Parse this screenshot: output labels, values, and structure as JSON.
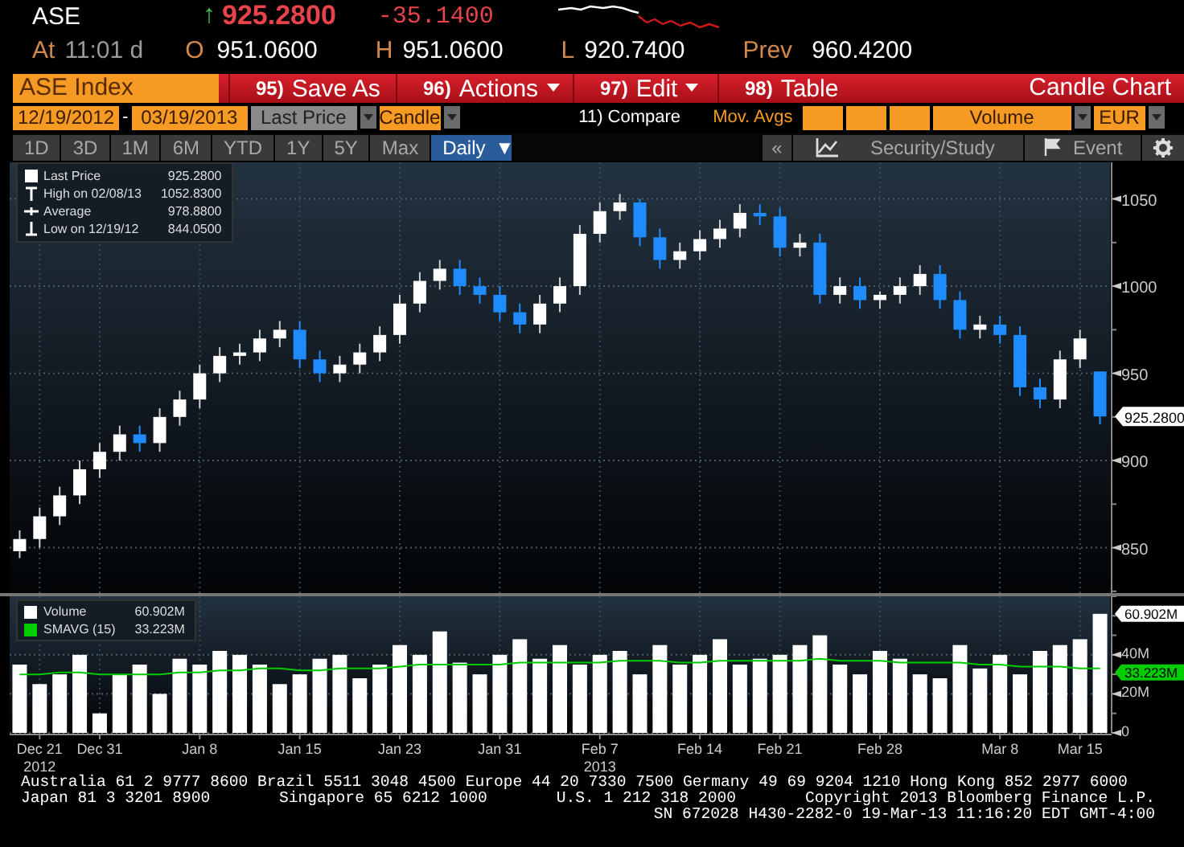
{
  "quote": {
    "ticker": "ASE",
    "arrow": "↑",
    "last": "925.2800",
    "change": "-35.1400",
    "at_label": "At",
    "time": "11:01 d",
    "open_label": "O",
    "open": "951.0600",
    "high_label": "H",
    "high": "951.0600",
    "low_label": "L",
    "low": "920.7400",
    "prev_label": "Prev",
    "prev": "960.4200"
  },
  "menu_bar": {
    "security": "ASE Index",
    "buttons": [
      {
        "number": "95)",
        "label": "Save As",
        "dropdown": false
      },
      {
        "number": "96)",
        "label": "Actions",
        "dropdown": true
      },
      {
        "number": "97)",
        "label": "Edit",
        "dropdown": true
      },
      {
        "number": "98)",
        "label": "Table",
        "dropdown": false
      }
    ],
    "title": "Candle Chart"
  },
  "settings_bar": {
    "start_date": "12/19/2012",
    "separator": "-",
    "end_date": "03/19/2013",
    "field": "Last Price",
    "style": "Candle",
    "compare": "11) Compare",
    "mov_avgs": "Mov. Avgs",
    "volume": "Volume",
    "currency": "EUR"
  },
  "period_tabs": [
    {
      "label": "1D",
      "selected": false
    },
    {
      "label": "3D",
      "selected": false
    },
    {
      "label": "1M",
      "selected": false
    },
    {
      "label": "6M",
      "selected": false
    },
    {
      "label": "YTD",
      "selected": false
    },
    {
      "label": "1Y",
      "selected": false
    },
    {
      "label": "5Y",
      "selected": false
    },
    {
      "label": "Max",
      "selected": false
    }
  ],
  "frequency": "Daily",
  "frequency_arrow": "▼",
  "right_tools": {
    "collapse": "«",
    "security_study": "Security/Study",
    "event": "Event"
  },
  "legend": [
    {
      "kind": "last",
      "label": "Last Price",
      "value": "925.2800"
    },
    {
      "kind": "high",
      "label": "High on 02/08/13",
      "value": "1052.8300"
    },
    {
      "kind": "average",
      "label": "Average",
      "value": "978.8800"
    },
    {
      "kind": "low",
      "label": "Low on 12/19/12",
      "value": "844.0500"
    }
  ],
  "price_chart": {
    "last_tag": "925.2800",
    "chart_data": {
      "type": "candlestick",
      "grid": true,
      "ylim": [
        824,
        1071
      ],
      "yticks": [
        850,
        900,
        950,
        1000,
        1050
      ],
      "categories": [
        null,
        null,
        null,
        null,
        null,
        null,
        null,
        null,
        null,
        null,
        null,
        null,
        null,
        null,
        null,
        null,
        null,
        null,
        null,
        null,
        null,
        null,
        null,
        null,
        null,
        null,
        null,
        null,
        null,
        null,
        null,
        null,
        null,
        null,
        null,
        null,
        null,
        null,
        null,
        null,
        null,
        null,
        null,
        null,
        null,
        null,
        null,
        null,
        null,
        null,
        null,
        null,
        null,
        null,
        null
      ],
      "ohlc": [
        [
          848,
          860,
          844.05,
          855
        ],
        [
          855,
          873,
          850,
          868
        ],
        [
          868,
          885,
          863,
          880
        ],
        [
          880,
          900,
          875,
          895
        ],
        [
          895,
          910,
          890,
          905
        ],
        [
          905,
          920,
          900,
          915
        ],
        [
          915,
          920,
          905,
          910
        ],
        [
          910,
          930,
          905,
          925
        ],
        [
          925,
          940,
          920,
          935
        ],
        [
          935,
          955,
          930,
          950
        ],
        [
          950,
          965,
          945,
          960
        ],
        [
          960,
          967,
          955,
          962
        ],
        [
          962,
          975,
          957,
          970
        ],
        [
          970,
          980,
          965,
          975
        ],
        [
          975,
          980,
          953,
          958
        ],
        [
          958,
          963,
          945,
          950
        ],
        [
          950,
          960,
          945,
          955
        ],
        [
          955,
          967,
          950,
          962
        ],
        [
          962,
          977,
          957,
          972
        ],
        [
          972,
          995,
          967,
          990
        ],
        [
          990,
          1008,
          985,
          1003
        ],
        [
          1003,
          1015,
          998,
          1010
        ],
        [
          1010,
          1015,
          995,
          1000
        ],
        [
          1000,
          1005,
          990,
          995
        ],
        [
          995,
          1000,
          980,
          985
        ],
        [
          985,
          990,
          973,
          978
        ],
        [
          978,
          995,
          973,
          990
        ],
        [
          990,
          1005,
          985,
          1000
        ],
        [
          1000,
          1035,
          995,
          1030
        ],
        [
          1030,
          1048,
          1025,
          1043
        ],
        [
          1043,
          1052.83,
          1038,
          1048
        ],
        [
          1048,
          1050,
          1023,
          1028
        ],
        [
          1028,
          1033,
          1010,
          1015
        ],
        [
          1015,
          1025,
          1010,
          1020
        ],
        [
          1020,
          1032,
          1015,
          1027
        ],
        [
          1027,
          1038,
          1022,
          1033
        ],
        [
          1033,
          1047,
          1028,
          1042
        ],
        [
          1042,
          1047,
          1035,
          1040
        ],
        [
          1040,
          1045,
          1017,
          1022
        ],
        [
          1022,
          1030,
          1017,
          1025
        ],
        [
          1025,
          1030,
          990,
          995
        ],
        [
          995,
          1005,
          990,
          1000
        ],
        [
          1000,
          1005,
          987,
          992
        ],
        [
          992,
          997,
          987,
          995
        ],
        [
          995,
          1005,
          990,
          1000
        ],
        [
          1000,
          1012,
          995,
          1007
        ],
        [
          1007,
          1012,
          987,
          992
        ],
        [
          992,
          997,
          970,
          975
        ],
        [
          975,
          983,
          970,
          978
        ],
        [
          978,
          983,
          967,
          972
        ],
        [
          972,
          977,
          937,
          942
        ],
        [
          942,
          947,
          930,
          935
        ],
        [
          935,
          963,
          930,
          958
        ],
        [
          958,
          975,
          953,
          970
        ],
        [
          951.06,
          951.06,
          920.74,
          925.28
        ]
      ]
    }
  },
  "volume_legend": [
    {
      "value": "60.902M"
    },
    {
      "value": "33.223M"
    }
  ],
  "volume_chart": {
    "volume_tag": "60.902M",
    "average_tag": "33.223M",
    "years": [
      "2012",
      "2013"
    ],
    "chart_data": {
      "type": "bar",
      "grid": true,
      "ylim": [
        0,
        70
      ],
      "yticks": [
        {
          "value": 0,
          "label": "0"
        },
        {
          "value": 20,
          "label": "20M"
        },
        {
          "value": 40,
          "label": "40M"
        }
      ],
      "categories": [
        null,
        "Dec 21",
        null,
        null,
        "Dec 31",
        null,
        null,
        null,
        null,
        "Jan 8",
        null,
        null,
        null,
        null,
        "Jan 15",
        null,
        null,
        null,
        null,
        "Jan 23",
        null,
        null,
        null,
        null,
        "Jan 31",
        null,
        null,
        null,
        null,
        "Feb 7",
        null,
        null,
        null,
        null,
        "Feb 14",
        null,
        null,
        null,
        "Feb 21",
        null,
        null,
        null,
        null,
        "Feb 28",
        null,
        null,
        null,
        null,
        null,
        "Mar 8",
        null,
        null,
        null,
        "Mar 15",
        null
      ],
      "series": [
        {
          "name": "Volume",
          "type": "bar",
          "color": "#ffffff",
          "values": [
            35,
            25,
            30,
            40,
            10,
            30,
            35,
            20,
            38,
            35,
            42,
            40,
            35,
            25,
            30,
            38,
            40,
            28,
            35,
            45,
            40,
            52,
            36,
            30,
            40,
            48,
            38,
            45,
            35,
            40,
            42,
            30,
            45,
            35,
            40,
            48,
            35,
            38,
            40,
            45,
            50,
            35,
            30,
            42,
            38,
            30,
            28,
            45,
            33,
            40,
            30,
            42,
            45,
            48,
            61
          ]
        },
        {
          "name": "SMAVG (15)",
          "type": "line",
          "color": "#00cc00",
          "values": [
            30,
            30,
            31,
            31,
            30,
            30,
            30,
            30,
            31,
            31,
            32,
            32,
            33,
            33,
            32,
            32,
            33,
            33,
            33,
            34,
            35,
            35,
            35,
            35,
            35,
            36,
            36,
            36,
            36,
            36,
            37,
            37,
            37,
            36,
            36,
            37,
            37,
            37,
            37,
            37,
            38,
            37,
            37,
            37,
            36,
            36,
            36,
            36,
            35,
            35,
            34,
            34,
            34,
            33,
            33
          ]
        }
      ]
    }
  },
  "footer": {
    "lines": [
      [
        "Australia 61 2 9777 8600 Brazil 5511 3048 4500 Europe 44 20 7330 7500 Germany 49 69 9204 1210 Hong Kong 852 2977 6000"
      ],
      [
        "Japan 81 3 3201 8900",
        "Singapore 65 6212 1000",
        "U.S. 1 212 318 2000",
        "Copyright 2013 Bloomberg Finance L.P."
      ],
      [
        "SN 672028 H430-2282-0 19-Mar-13 11:16:20 EDT  GMT-4:00"
      ]
    ]
  }
}
